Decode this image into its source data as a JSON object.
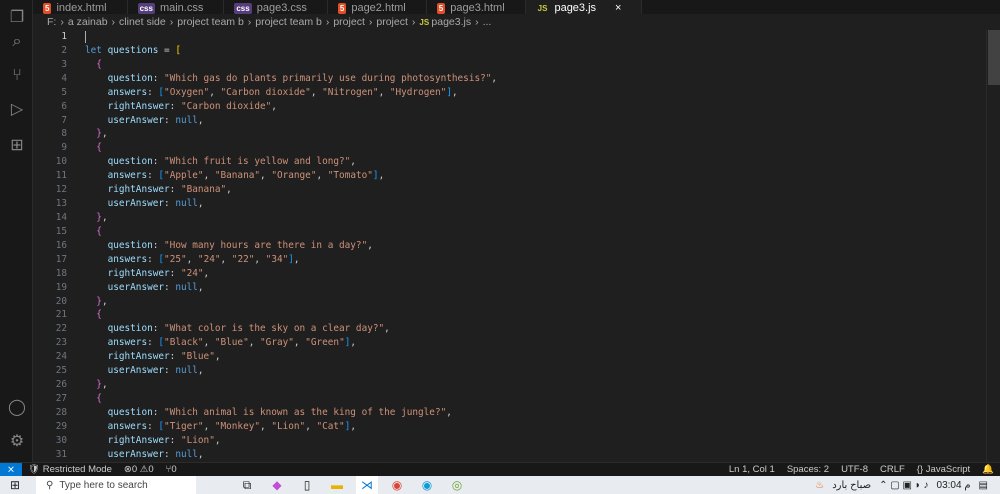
{
  "tabs": [
    {
      "label": "index.html",
      "type": "html"
    },
    {
      "label": "main.css",
      "type": "css"
    },
    {
      "label": "page3.css",
      "type": "css"
    },
    {
      "label": "page2.html",
      "type": "html"
    },
    {
      "label": "page3.html",
      "type": "html"
    },
    {
      "label": "page3.js",
      "type": "js",
      "active": true
    }
  ],
  "close_icon": "×",
  "breadcrumb": [
    "F:",
    "a zainab",
    "clinet side",
    "project  team b",
    "project  team b",
    "project",
    "project",
    "page3.js",
    "..."
  ],
  "colors": {
    "keyword": "#569cd6",
    "var": "#9cdcfe",
    "str": "#ce9178",
    "p1": "#ffd700",
    "p2": "#da70d6",
    "p3": "#179fff",
    "punc": "#cccccc"
  },
  "code": [
    [],
    [
      [
        "keyword",
        "let"
      ],
      [
        "punc",
        " "
      ],
      [
        "var",
        "questions"
      ],
      [
        "punc",
        " = "
      ],
      [
        "p1",
        "["
      ]
    ],
    [
      [
        "punc",
        "  "
      ],
      [
        "p2",
        "{"
      ]
    ],
    [
      [
        "punc",
        "    "
      ],
      [
        "var",
        "question"
      ],
      [
        "punc",
        ": "
      ],
      [
        "str",
        "\"Which gas do plants primarily use during photosynthesis?\""
      ],
      [
        "punc",
        ","
      ]
    ],
    [
      [
        "punc",
        "    "
      ],
      [
        "var",
        "answers"
      ],
      [
        "punc",
        ": "
      ],
      [
        "p3",
        "["
      ],
      [
        "str",
        "\"Oxygen\""
      ],
      [
        "punc",
        ", "
      ],
      [
        "str",
        "\"Carbon dioxide\""
      ],
      [
        "punc",
        ", "
      ],
      [
        "str",
        "\"Nitrogen\""
      ],
      [
        "punc",
        ", "
      ],
      [
        "str",
        "\"Hydrogen\""
      ],
      [
        "p3",
        "]"
      ],
      [
        "punc",
        ","
      ]
    ],
    [
      [
        "punc",
        "    "
      ],
      [
        "var",
        "rightAnswer"
      ],
      [
        "punc",
        ": "
      ],
      [
        "str",
        "\"Carbon dioxide\""
      ],
      [
        "punc",
        ","
      ]
    ],
    [
      [
        "punc",
        "    "
      ],
      [
        "var",
        "userAnswer"
      ],
      [
        "punc",
        ": "
      ],
      [
        "keyword",
        "null"
      ],
      [
        "punc",
        ","
      ]
    ],
    [
      [
        "punc",
        "  "
      ],
      [
        "p2",
        "}"
      ],
      [
        "punc",
        ","
      ]
    ],
    [
      [
        "punc",
        "  "
      ],
      [
        "p2",
        "{"
      ]
    ],
    [
      [
        "punc",
        "    "
      ],
      [
        "var",
        "question"
      ],
      [
        "punc",
        ": "
      ],
      [
        "str",
        "\"Which fruit is yellow and long?\""
      ],
      [
        "punc",
        ","
      ]
    ],
    [
      [
        "punc",
        "    "
      ],
      [
        "var",
        "answers"
      ],
      [
        "punc",
        ": "
      ],
      [
        "p3",
        "["
      ],
      [
        "str",
        "\"Apple\""
      ],
      [
        "punc",
        ", "
      ],
      [
        "str",
        "\"Banana\""
      ],
      [
        "punc",
        ", "
      ],
      [
        "str",
        "\"Orange\""
      ],
      [
        "punc",
        ", "
      ],
      [
        "str",
        "\"Tomato\""
      ],
      [
        "p3",
        "]"
      ],
      [
        "punc",
        ","
      ]
    ],
    [
      [
        "punc",
        "    "
      ],
      [
        "var",
        "rightAnswer"
      ],
      [
        "punc",
        ": "
      ],
      [
        "str",
        "\"Banana\""
      ],
      [
        "punc",
        ","
      ]
    ],
    [
      [
        "punc",
        "    "
      ],
      [
        "var",
        "userAnswer"
      ],
      [
        "punc",
        ": "
      ],
      [
        "keyword",
        "null"
      ],
      [
        "punc",
        ","
      ]
    ],
    [
      [
        "punc",
        "  "
      ],
      [
        "p2",
        "}"
      ],
      [
        "punc",
        ","
      ]
    ],
    [
      [
        "punc",
        "  "
      ],
      [
        "p2",
        "{"
      ]
    ],
    [
      [
        "punc",
        "    "
      ],
      [
        "var",
        "question"
      ],
      [
        "punc",
        ": "
      ],
      [
        "str",
        "\"How many hours are there in a day?\""
      ],
      [
        "punc",
        ","
      ]
    ],
    [
      [
        "punc",
        "    "
      ],
      [
        "var",
        "answers"
      ],
      [
        "punc",
        ": "
      ],
      [
        "p3",
        "["
      ],
      [
        "str",
        "\"25\""
      ],
      [
        "punc",
        ", "
      ],
      [
        "str",
        "\"24\""
      ],
      [
        "punc",
        ", "
      ],
      [
        "str",
        "\"22\""
      ],
      [
        "punc",
        ", "
      ],
      [
        "str",
        "\"34\""
      ],
      [
        "p3",
        "]"
      ],
      [
        "punc",
        ","
      ]
    ],
    [
      [
        "punc",
        "    "
      ],
      [
        "var",
        "rightAnswer"
      ],
      [
        "punc",
        ": "
      ],
      [
        "str",
        "\"24\""
      ],
      [
        "punc",
        ","
      ]
    ],
    [
      [
        "punc",
        "    "
      ],
      [
        "var",
        "userAnswer"
      ],
      [
        "punc",
        ": "
      ],
      [
        "keyword",
        "null"
      ],
      [
        "punc",
        ","
      ]
    ],
    [
      [
        "punc",
        "  "
      ],
      [
        "p2",
        "}"
      ],
      [
        "punc",
        ","
      ]
    ],
    [
      [
        "punc",
        "  "
      ],
      [
        "p2",
        "{"
      ]
    ],
    [
      [
        "punc",
        "    "
      ],
      [
        "var",
        "question"
      ],
      [
        "punc",
        ": "
      ],
      [
        "str",
        "\"What color is the sky on a clear day?\""
      ],
      [
        "punc",
        ","
      ]
    ],
    [
      [
        "punc",
        "    "
      ],
      [
        "var",
        "answers"
      ],
      [
        "punc",
        ": "
      ],
      [
        "p3",
        "["
      ],
      [
        "str",
        "\"Black\""
      ],
      [
        "punc",
        ", "
      ],
      [
        "str",
        "\"Blue\""
      ],
      [
        "punc",
        ", "
      ],
      [
        "str",
        "\"Gray\""
      ],
      [
        "punc",
        ", "
      ],
      [
        "str",
        "\"Green\""
      ],
      [
        "p3",
        "]"
      ],
      [
        "punc",
        ","
      ]
    ],
    [
      [
        "punc",
        "    "
      ],
      [
        "var",
        "rightAnswer"
      ],
      [
        "punc",
        ": "
      ],
      [
        "str",
        "\"Blue\""
      ],
      [
        "punc",
        ","
      ]
    ],
    [
      [
        "punc",
        "    "
      ],
      [
        "var",
        "userAnswer"
      ],
      [
        "punc",
        ": "
      ],
      [
        "keyword",
        "null"
      ],
      [
        "punc",
        ","
      ]
    ],
    [
      [
        "punc",
        "  "
      ],
      [
        "p2",
        "}"
      ],
      [
        "punc",
        ","
      ]
    ],
    [
      [
        "punc",
        "  "
      ],
      [
        "p2",
        "{"
      ]
    ],
    [
      [
        "punc",
        "    "
      ],
      [
        "var",
        "question"
      ],
      [
        "punc",
        ": "
      ],
      [
        "str",
        "\"Which animal is known as the king of the jungle?\""
      ],
      [
        "punc",
        ","
      ]
    ],
    [
      [
        "punc",
        "    "
      ],
      [
        "var",
        "answers"
      ],
      [
        "punc",
        ": "
      ],
      [
        "p3",
        "["
      ],
      [
        "str",
        "\"Tiger\""
      ],
      [
        "punc",
        ", "
      ],
      [
        "str",
        "\"Monkey\""
      ],
      [
        "punc",
        ", "
      ],
      [
        "str",
        "\"Lion\""
      ],
      [
        "punc",
        ", "
      ],
      [
        "str",
        "\"Cat\""
      ],
      [
        "p3",
        "]"
      ],
      [
        "punc",
        ","
      ]
    ],
    [
      [
        "punc",
        "    "
      ],
      [
        "var",
        "rightAnswer"
      ],
      [
        "punc",
        ": "
      ],
      [
        "str",
        "\"Lion\""
      ],
      [
        "punc",
        ","
      ]
    ],
    [
      [
        "punc",
        "    "
      ],
      [
        "var",
        "userAnswer"
      ],
      [
        "punc",
        ": "
      ],
      [
        "keyword",
        "null"
      ],
      [
        "punc",
        ","
      ]
    ]
  ],
  "status": {
    "remote": "⨯",
    "restricted": "Restricted Mode",
    "errors": "0",
    "warnings": "0",
    "ports": "0",
    "position": "Ln 1, Col 1",
    "spaces": "Spaces: 2",
    "encoding": "UTF-8",
    "eol": "CRLF",
    "language": "JavaScript"
  },
  "taskbar": {
    "search_placeholder": "Type here to search",
    "weather": "صباح بارد",
    "time": "03:04 م"
  }
}
